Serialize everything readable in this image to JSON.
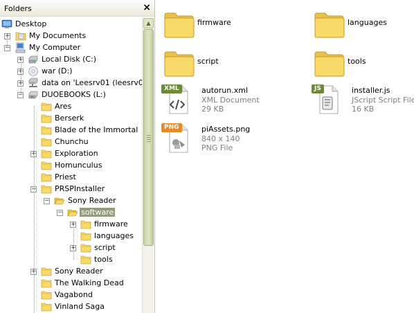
{
  "folders_pane": {
    "title": "Folders",
    "close_glyph": "×",
    "scroll_up_glyph": "▲"
  },
  "tree": [
    {
      "id": "desktop",
      "label": "Desktop",
      "icon": "desktop-icon",
      "depth": 0,
      "expander": ""
    },
    {
      "id": "my-documents",
      "label": "My Documents",
      "icon": "folder-docs-icon",
      "depth": 1,
      "expander": "+"
    },
    {
      "id": "my-computer",
      "label": "My Computer",
      "icon": "computer-icon",
      "depth": 1,
      "expander": "−"
    },
    {
      "id": "local-disk",
      "label": "Local Disk (C:)",
      "icon": "hard-drive-icon",
      "depth": 2,
      "expander": "+"
    },
    {
      "id": "war-d",
      "label": "war (D:)",
      "icon": "cd-drive-icon",
      "depth": 2,
      "expander": "+"
    },
    {
      "id": "network-drive",
      "label": "data on 'Leesrv01 (leesrv01)'",
      "icon": "network-drive-icon",
      "depth": 2,
      "expander": "+"
    },
    {
      "id": "duoebooks",
      "label": "DUOEBOOKS (L:)",
      "icon": "removable-drive-icon",
      "depth": 2,
      "expander": "−"
    },
    {
      "id": "ares",
      "label": "Ares",
      "icon": "folder-icon",
      "depth": 3,
      "expander": ""
    },
    {
      "id": "berserk",
      "label": "Berserk",
      "icon": "folder-icon",
      "depth": 3,
      "expander": ""
    },
    {
      "id": "blade",
      "label": "Blade of the Immortal",
      "icon": "folder-icon",
      "depth": 3,
      "expander": ""
    },
    {
      "id": "chunchu",
      "label": "Chunchu",
      "icon": "folder-icon",
      "depth": 3,
      "expander": ""
    },
    {
      "id": "exploration",
      "label": "Exploration",
      "icon": "folder-icon",
      "depth": 3,
      "expander": "+"
    },
    {
      "id": "homunculus",
      "label": "Homunculus",
      "icon": "folder-icon",
      "depth": 3,
      "expander": ""
    },
    {
      "id": "priest",
      "label": "Priest",
      "icon": "folder-icon",
      "depth": 3,
      "expander": ""
    },
    {
      "id": "prspinstaller",
      "label": "PRSPInstaller",
      "icon": "folder-icon",
      "depth": 3,
      "expander": "−"
    },
    {
      "id": "sony-reader-inner",
      "label": "Sony Reader",
      "icon": "folder-open-icon",
      "depth": 4,
      "expander": "−"
    },
    {
      "id": "software",
      "label": "software",
      "icon": "folder-open-icon",
      "depth": 5,
      "expander": "−",
      "selected": true
    },
    {
      "id": "firmware",
      "label": "firmware",
      "icon": "folder-icon",
      "depth": 6,
      "expander": "+"
    },
    {
      "id": "languages",
      "label": "languages",
      "icon": "folder-icon",
      "depth": 6,
      "expander": ""
    },
    {
      "id": "script",
      "label": "script",
      "icon": "folder-icon",
      "depth": 6,
      "expander": "+"
    },
    {
      "id": "tools",
      "label": "tools",
      "icon": "folder-icon",
      "depth": 6,
      "expander": ""
    },
    {
      "id": "sony-reader",
      "label": "Sony Reader",
      "icon": "folder-icon",
      "depth": 3,
      "expander": "+"
    },
    {
      "id": "walking-dead",
      "label": "The Walking Dead",
      "icon": "folder-icon",
      "depth": 3,
      "expander": ""
    },
    {
      "id": "vagabond",
      "label": "Vagabond",
      "icon": "folder-icon",
      "depth": 3,
      "expander": ""
    },
    {
      "id": "vinland",
      "label": "Vinland Saga",
      "icon": "folder-icon",
      "depth": 3,
      "expander": ""
    }
  ],
  "content": {
    "items": [
      {
        "id": "firmware",
        "name": "firmware",
        "kind": "folder",
        "icon": "large-folder-icon",
        "lines": []
      },
      {
        "id": "languages",
        "name": "languages",
        "kind": "folder",
        "icon": "large-folder-icon",
        "lines": []
      },
      {
        "id": "script",
        "name": "script",
        "kind": "folder",
        "icon": "large-folder-icon",
        "lines": []
      },
      {
        "id": "tools",
        "name": "tools",
        "kind": "folder",
        "icon": "large-folder-icon",
        "lines": []
      },
      {
        "id": "autorun",
        "name": "autorun.xml",
        "kind": "xml",
        "badge": "XML",
        "icon": "xml-file-icon",
        "lines": [
          "XML Document",
          "29 KB"
        ]
      },
      {
        "id": "installer",
        "name": "installer.js",
        "kind": "js",
        "badge": "JS",
        "icon": "js-file-icon",
        "lines": [
          "JScript Script File",
          "16 KB"
        ]
      },
      {
        "id": "piassets",
        "name": "piAssets.png",
        "kind": "png",
        "badge": "PNG",
        "icon": "png-file-icon",
        "lines": [
          "840 x 140",
          "PNG File"
        ]
      }
    ]
  },
  "colors": {
    "folder_yellow": "#f9d967",
    "selection": "#919c78",
    "xml_badge": "#6d8a36",
    "js_badge": "#6d8a36",
    "png_badge": "#e58b2a"
  }
}
